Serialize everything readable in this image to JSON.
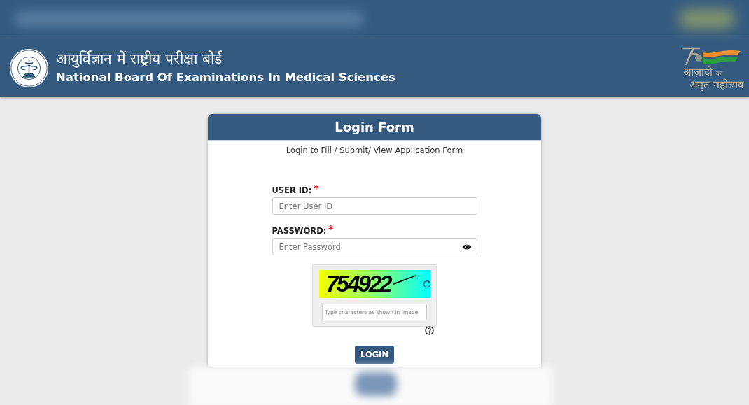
{
  "header": {
    "title_hindi": "आयुर्विज्ञान में राष्ट्रीय परीक्षा बोर्ड",
    "title": "National Board Of Examinations In Medical Sciences",
    "emblem_line1": "आज़ादी",
    "emblem_small": "का",
    "emblem_line2": "अमृत महोत्सव"
  },
  "form": {
    "title": "Login Form",
    "subtitle": "Login to Fill / Submit/ View Application Form",
    "fields": [
      {
        "label": "USER ID:",
        "required_mark": "*",
        "placeholder": "Enter User ID",
        "kind": "text"
      },
      {
        "label": "PASSWORD:",
        "required_mark": "*",
        "placeholder": "Enter Password",
        "kind": "password"
      }
    ],
    "captcha": {
      "code": "754922",
      "placeholder": "Type characters as shown in image"
    },
    "button": "LOGIN"
  }
}
